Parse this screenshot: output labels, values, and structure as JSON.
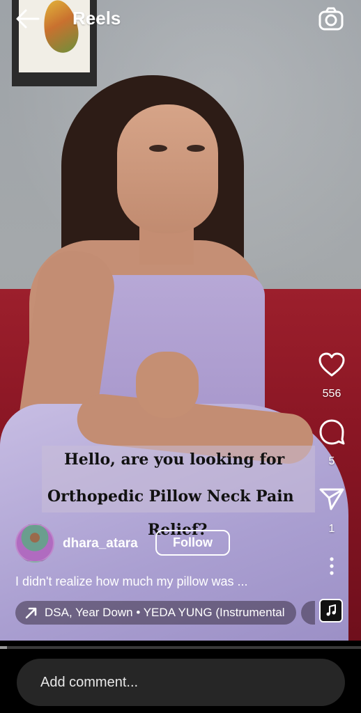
{
  "header": {
    "title": "Reels",
    "back_icon": "arrow-left-icon",
    "camera_icon": "camera-icon"
  },
  "actions": {
    "like_icon": "heart-icon",
    "likes": "556",
    "comment_icon": "comment-bubble-icon",
    "comments": "5",
    "share_icon": "send-icon",
    "shares": "1",
    "more_icon": "more-vertical-icon"
  },
  "video_overlay": {
    "line1": "Hello, are you looking for",
    "line2": "Orthopedic Pillow Neck Pain",
    "line3": "Relief?"
  },
  "author": {
    "username": "dhara_atara",
    "follow_label": "Follow"
  },
  "caption": "I didn't realize how much my pillow was ...",
  "audio": {
    "icon": "trending-arrow-icon",
    "label": "DSA, Year Down • YEDA YUNG (Instrumental"
  },
  "playback": {
    "progress_fraction": 0.02
  },
  "comment": {
    "placeholder": "Add comment..."
  },
  "colors": {
    "background": "#000000",
    "comment_field": "#262626"
  }
}
